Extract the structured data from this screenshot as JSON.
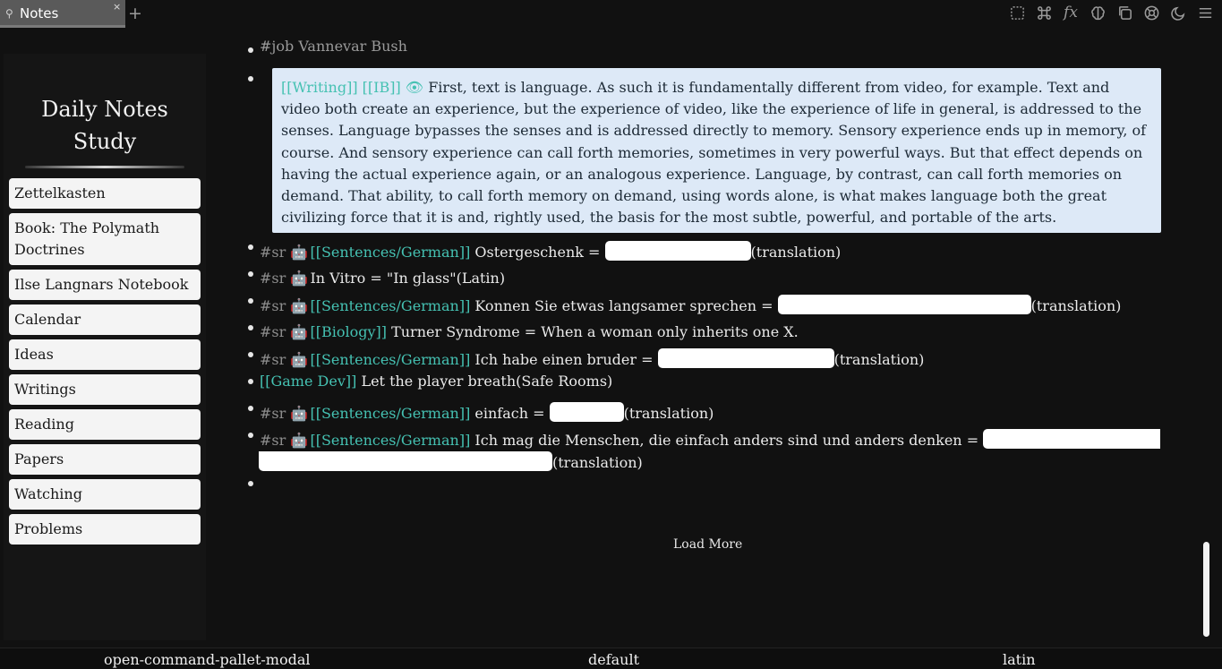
{
  "tabs": [
    {
      "label": "Notes",
      "close": "×"
    }
  ],
  "tab_add": "+",
  "toolbar": {
    "icons": [
      "square-select-icon",
      "command-icon",
      "function-icon",
      "brain-icon",
      "copy-pages-icon",
      "lifebuoy-icon",
      "moon-icon",
      "menu-icon"
    ],
    "fx_label": "fx"
  },
  "sidebar": {
    "title_line1": "Daily Notes",
    "title_line2": "Study",
    "items": [
      {
        "label": "Zettelkasten"
      },
      {
        "label": "Book: The Polymath Doctrines"
      },
      {
        "label": "Ilse Langnars Notebook"
      },
      {
        "label": "Calendar"
      },
      {
        "label": "Ideas"
      },
      {
        "label": "Writings"
      },
      {
        "label": "Reading"
      },
      {
        "label": "Papers"
      },
      {
        "label": "Watching"
      },
      {
        "label": "Problems"
      }
    ]
  },
  "main": {
    "top_partial": "#job Vannevar Bush",
    "quote": {
      "link1": "[[Writing]]",
      "link2": "[[IB]]",
      "text": "First, text is language. As such it is fundamentally different from video, for example. Text and video both create an experience, but the experience of video, like the experience of life in general, is addressed to the senses. Language bypasses the senses and is addressed directly to memory. Sensory experience ends up in memory, of course. And sensory experience can call forth memories, sometimes in very powerful ways. But that effect depends on having the actual experience again, or an analogous experience. Language, by contrast, can call forth memories on demand. That ability, to call forth memory on demand, using words alone, is what makes language both the great civilizing force that it is and, rightly used, the basis for the most subtle, powerful, and portable of the arts."
    },
    "rows": [
      {
        "tag": "#sr",
        "link": "[[Sentences/German]]",
        "text": "Ostergeschenk =",
        "suffix": "(translation)"
      },
      {
        "tag": "#sr",
        "link": "",
        "text": "In Vitro = \"In glass\"(Latin)",
        "suffix": ""
      },
      {
        "tag": "#sr",
        "link": "[[Sentences/German]]",
        "text": "Konnen Sie etwas langsamer sprechen =",
        "suffix": "(translation)"
      },
      {
        "tag": "#sr",
        "link": "[[Biology]]",
        "text": "Turner Syndrome = When a woman only inherits one X.",
        "suffix": ""
      },
      {
        "tag": "#sr",
        "link": "[[Sentences/German]]",
        "text": "Ich habe einen bruder =",
        "suffix": "(translation)"
      },
      {
        "tag": "",
        "link": "[[Game Dev]]",
        "text": "Let the player breath(Safe Rooms)",
        "suffix": ""
      },
      {
        "tag": "#sr",
        "link": "[[Sentences/German]]",
        "text": "einfach =",
        "suffix": "(translation)"
      },
      {
        "tag": "#sr",
        "link": "[[Sentences/German]]",
        "text": "Ich mag die Menschen, die einfach anders sind und anders denken =",
        "suffix": "(translation)"
      }
    ],
    "load_more": "Load More"
  },
  "statusbar": {
    "left": "open-command-pallet-modal",
    "center": "default",
    "right": "latin"
  },
  "colors": {
    "background": "#111111",
    "link": "#45c1b2",
    "quote_bg": "#dde9f7",
    "sidebar_button": "#f4f4f4"
  }
}
